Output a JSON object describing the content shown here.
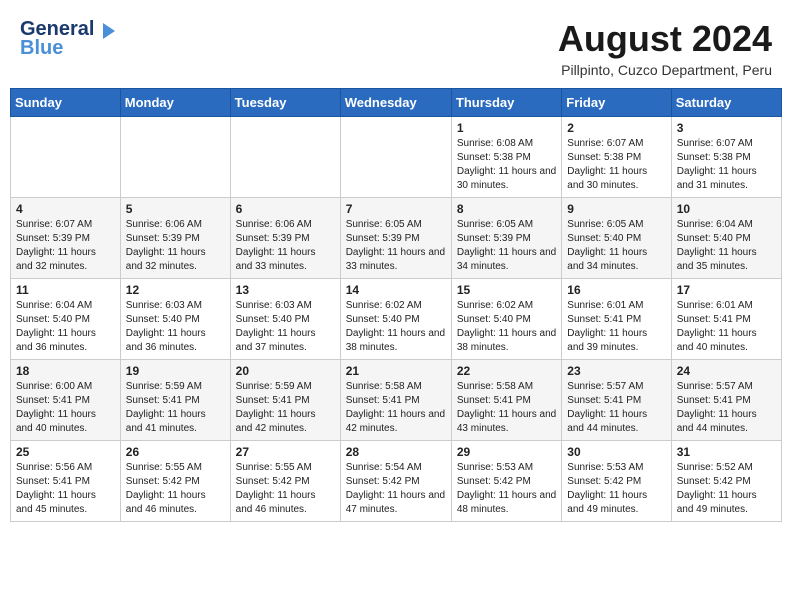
{
  "header": {
    "logo_line1": "General",
    "logo_line2": "Blue",
    "month_year": "August 2024",
    "location": "Pillpinto, Cuzco Department, Peru"
  },
  "days_of_week": [
    "Sunday",
    "Monday",
    "Tuesday",
    "Wednesday",
    "Thursday",
    "Friday",
    "Saturday"
  ],
  "weeks": [
    [
      {
        "day": "",
        "info": ""
      },
      {
        "day": "",
        "info": ""
      },
      {
        "day": "",
        "info": ""
      },
      {
        "day": "",
        "info": ""
      },
      {
        "day": "1",
        "info": "Sunrise: 6:08 AM\nSunset: 5:38 PM\nDaylight: 11 hours and 30 minutes."
      },
      {
        "day": "2",
        "info": "Sunrise: 6:07 AM\nSunset: 5:38 PM\nDaylight: 11 hours and 30 minutes."
      },
      {
        "day": "3",
        "info": "Sunrise: 6:07 AM\nSunset: 5:38 PM\nDaylight: 11 hours and 31 minutes."
      }
    ],
    [
      {
        "day": "4",
        "info": "Sunrise: 6:07 AM\nSunset: 5:39 PM\nDaylight: 11 hours and 32 minutes."
      },
      {
        "day": "5",
        "info": "Sunrise: 6:06 AM\nSunset: 5:39 PM\nDaylight: 11 hours and 32 minutes."
      },
      {
        "day": "6",
        "info": "Sunrise: 6:06 AM\nSunset: 5:39 PM\nDaylight: 11 hours and 33 minutes."
      },
      {
        "day": "7",
        "info": "Sunrise: 6:05 AM\nSunset: 5:39 PM\nDaylight: 11 hours and 33 minutes."
      },
      {
        "day": "8",
        "info": "Sunrise: 6:05 AM\nSunset: 5:39 PM\nDaylight: 11 hours and 34 minutes."
      },
      {
        "day": "9",
        "info": "Sunrise: 6:05 AM\nSunset: 5:40 PM\nDaylight: 11 hours and 34 minutes."
      },
      {
        "day": "10",
        "info": "Sunrise: 6:04 AM\nSunset: 5:40 PM\nDaylight: 11 hours and 35 minutes."
      }
    ],
    [
      {
        "day": "11",
        "info": "Sunrise: 6:04 AM\nSunset: 5:40 PM\nDaylight: 11 hours and 36 minutes."
      },
      {
        "day": "12",
        "info": "Sunrise: 6:03 AM\nSunset: 5:40 PM\nDaylight: 11 hours and 36 minutes."
      },
      {
        "day": "13",
        "info": "Sunrise: 6:03 AM\nSunset: 5:40 PM\nDaylight: 11 hours and 37 minutes."
      },
      {
        "day": "14",
        "info": "Sunrise: 6:02 AM\nSunset: 5:40 PM\nDaylight: 11 hours and 38 minutes."
      },
      {
        "day": "15",
        "info": "Sunrise: 6:02 AM\nSunset: 5:40 PM\nDaylight: 11 hours and 38 minutes."
      },
      {
        "day": "16",
        "info": "Sunrise: 6:01 AM\nSunset: 5:41 PM\nDaylight: 11 hours and 39 minutes."
      },
      {
        "day": "17",
        "info": "Sunrise: 6:01 AM\nSunset: 5:41 PM\nDaylight: 11 hours and 40 minutes."
      }
    ],
    [
      {
        "day": "18",
        "info": "Sunrise: 6:00 AM\nSunset: 5:41 PM\nDaylight: 11 hours and 40 minutes."
      },
      {
        "day": "19",
        "info": "Sunrise: 5:59 AM\nSunset: 5:41 PM\nDaylight: 11 hours and 41 minutes."
      },
      {
        "day": "20",
        "info": "Sunrise: 5:59 AM\nSunset: 5:41 PM\nDaylight: 11 hours and 42 minutes."
      },
      {
        "day": "21",
        "info": "Sunrise: 5:58 AM\nSunset: 5:41 PM\nDaylight: 11 hours and 42 minutes."
      },
      {
        "day": "22",
        "info": "Sunrise: 5:58 AM\nSunset: 5:41 PM\nDaylight: 11 hours and 43 minutes."
      },
      {
        "day": "23",
        "info": "Sunrise: 5:57 AM\nSunset: 5:41 PM\nDaylight: 11 hours and 44 minutes."
      },
      {
        "day": "24",
        "info": "Sunrise: 5:57 AM\nSunset: 5:41 PM\nDaylight: 11 hours and 44 minutes."
      }
    ],
    [
      {
        "day": "25",
        "info": "Sunrise: 5:56 AM\nSunset: 5:41 PM\nDaylight: 11 hours and 45 minutes."
      },
      {
        "day": "26",
        "info": "Sunrise: 5:55 AM\nSunset: 5:42 PM\nDaylight: 11 hours and 46 minutes."
      },
      {
        "day": "27",
        "info": "Sunrise: 5:55 AM\nSunset: 5:42 PM\nDaylight: 11 hours and 46 minutes."
      },
      {
        "day": "28",
        "info": "Sunrise: 5:54 AM\nSunset: 5:42 PM\nDaylight: 11 hours and 47 minutes."
      },
      {
        "day": "29",
        "info": "Sunrise: 5:53 AM\nSunset: 5:42 PM\nDaylight: 11 hours and 48 minutes."
      },
      {
        "day": "30",
        "info": "Sunrise: 5:53 AM\nSunset: 5:42 PM\nDaylight: 11 hours and 49 minutes."
      },
      {
        "day": "31",
        "info": "Sunrise: 5:52 AM\nSunset: 5:42 PM\nDaylight: 11 hours and 49 minutes."
      }
    ]
  ]
}
